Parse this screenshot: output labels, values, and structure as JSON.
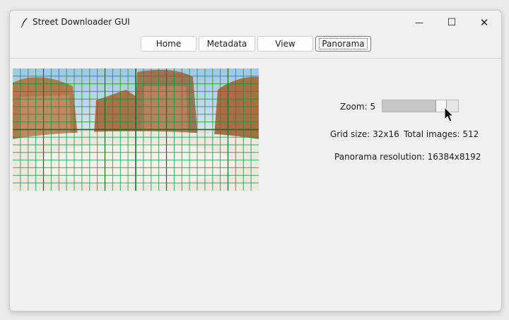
{
  "window": {
    "title": "Street Downloader GUI",
    "controls": {
      "minimize": "—",
      "maximize": "☐",
      "close": "✕"
    }
  },
  "tabs": [
    {
      "label": "Home",
      "active": false
    },
    {
      "label": "Metadata",
      "active": false
    },
    {
      "label": "View",
      "active": false
    },
    {
      "label": "Panorama",
      "active": true
    }
  ],
  "panorama": {
    "grid_color": "#1e8a2e",
    "sky_color": "#b7d4ea",
    "ground_color": "#e9e6df"
  },
  "zoom": {
    "label": "Zoom: 5",
    "value": 5,
    "min": 0,
    "max": 5,
    "fill_fraction": 0.72
  },
  "info": {
    "grid_size": "Grid size: 32x16",
    "total_images": "Total images: 512",
    "resolution": "Panorama resolution: 16384x8192"
  },
  "icons": {
    "app": "feather-icon",
    "cursor": "mouse-pointer-icon"
  }
}
